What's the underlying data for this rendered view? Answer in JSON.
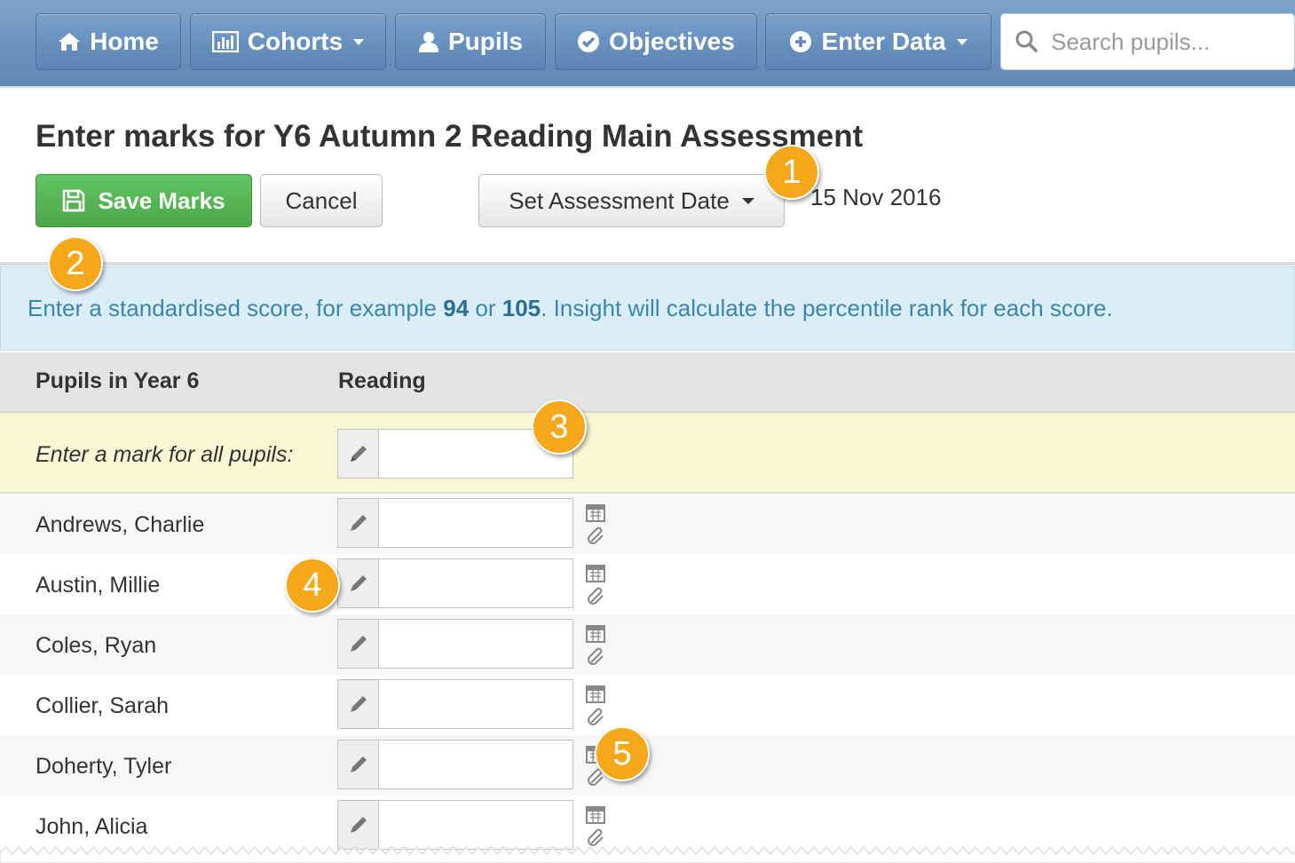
{
  "nav": {
    "home": "Home",
    "cohorts": "Cohorts",
    "pupils": "Pupils",
    "objectives": "Objectives",
    "enter_data": "Enter Data",
    "search_placeholder": "Search pupils..."
  },
  "page": {
    "title": "Enter marks for Y6 Autumn 2 Reading Main Assessment",
    "save_label": "Save Marks",
    "cancel_label": "Cancel",
    "set_date_label": "Set Assessment Date",
    "assessment_date": "15 Nov 2016"
  },
  "info": {
    "text_before": "Enter a standardised score, for example ",
    "example1": "94",
    "text_or": " or ",
    "example2": "105",
    "text_after": ". Insight will calculate the percentile rank for each score."
  },
  "table": {
    "col_pupils": "Pupils in Year 6",
    "col_reading": "Reading",
    "all_pupils_label": "Enter a mark for all pupils:",
    "all_value": "",
    "rows": [
      {
        "name": "Andrews, Charlie",
        "value": ""
      },
      {
        "name": "Austin, Millie",
        "value": ""
      },
      {
        "name": "Coles, Ryan",
        "value": ""
      },
      {
        "name": "Collier, Sarah",
        "value": ""
      },
      {
        "name": "Doherty, Tyler",
        "value": ""
      },
      {
        "name": "John, Alicia",
        "value": ""
      }
    ]
  },
  "callouts": [
    "1",
    "2",
    "3",
    "4",
    "5"
  ],
  "colors": {
    "nav": "#6b93c1",
    "save_green": "#5cb85c",
    "info_bg": "#dbedf6",
    "info_text": "#3a87ad",
    "callout": "#f6a71a",
    "highlight_row": "#f7f7d4"
  }
}
